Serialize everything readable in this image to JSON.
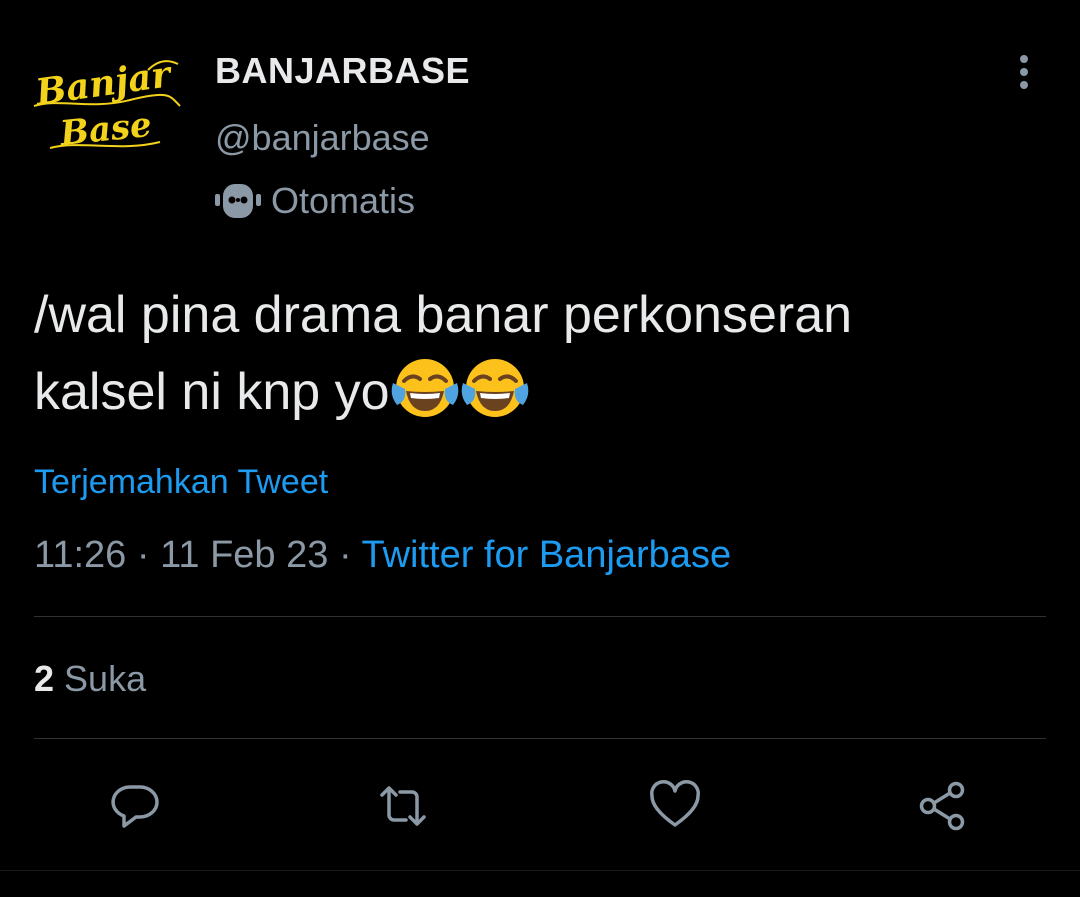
{
  "author": {
    "avatar_logo_text_top": "Banjar",
    "avatar_logo_text_bottom": "Base",
    "display_name": "BANJARBASE",
    "handle": "@banjarbase",
    "automated_label": "Otomatis",
    "automated_icon": "robot-icon"
  },
  "menu": {
    "icon": "more-vertical-icon"
  },
  "tweet": {
    "text_line1": "/wal pina drama banar perkonseran",
    "text_line2": "kalsel ni knp yo",
    "emoji": [
      "face-with-tears-of-joy",
      "face-with-tears-of-joy"
    ],
    "translate_label": "Terjemahkan Tweet",
    "time": "11:26",
    "separator": "·",
    "date": "11 Feb 23",
    "source": "Twitter for Banjarbase"
  },
  "stats": {
    "likes_count": "2",
    "likes_label": "Suka"
  },
  "actions": [
    {
      "name": "reply-icon"
    },
    {
      "name": "retweet-icon"
    },
    {
      "name": "like-icon"
    },
    {
      "name": "share-icon"
    }
  ],
  "colors": {
    "background": "#000000",
    "primary_text": "#e7e9ea",
    "secondary_text": "#8b98a5",
    "link": "#1d9bf0",
    "divider": "#2f3336",
    "logo": "#f2d21a"
  }
}
